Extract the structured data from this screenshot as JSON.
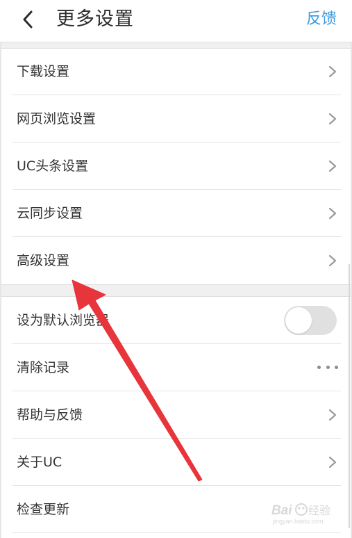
{
  "header": {
    "back_icon": "chevron-left-icon",
    "title": "更多设置",
    "feedback_label": "反馈",
    "accent_color": "#3d9be0"
  },
  "section1": {
    "items": [
      {
        "label": "下载设置",
        "control": "chevron-right-icon"
      },
      {
        "label": "网页浏览设置",
        "control": "chevron-right-icon"
      },
      {
        "label": "UC头条设置",
        "control": "chevron-right-icon"
      },
      {
        "label": "云同步设置",
        "control": "chevron-right-icon"
      },
      {
        "label": "高级设置",
        "control": "chevron-right-icon"
      }
    ]
  },
  "section2": {
    "items": [
      {
        "label": "设为默认浏览器",
        "control": "toggle",
        "toggle_on": false
      },
      {
        "label": "清除记录",
        "control": "more-dots-icon"
      },
      {
        "label": "帮助与反馈",
        "control": "chevron-right-icon"
      },
      {
        "label": "关于UC",
        "control": "chevron-right-icon"
      },
      {
        "label": "检查更新",
        "control": "none"
      }
    ]
  },
  "annotation": {
    "arrow_color": "#e8343b",
    "points_to": "高级设置"
  },
  "watermark": {
    "text": "Baidu经验",
    "subtext": "jingyan.baidu.com"
  }
}
